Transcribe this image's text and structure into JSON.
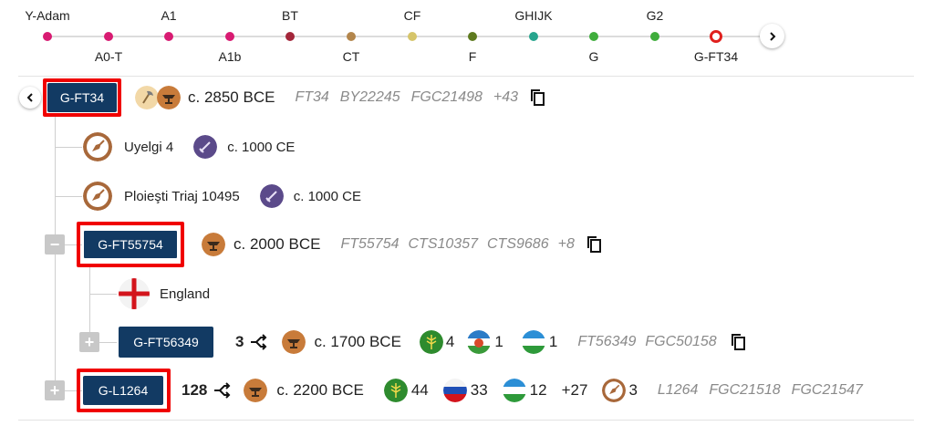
{
  "rail": {
    "nodes": [
      {
        "label": "Y-Adam",
        "pos": "top",
        "color": "#d81b72"
      },
      {
        "label": "A0-T",
        "pos": "bottom",
        "color": "#d81b72"
      },
      {
        "label": "A1",
        "pos": "top",
        "color": "#d81b72"
      },
      {
        "label": "A1b",
        "pos": "bottom",
        "color": "#d81b72"
      },
      {
        "label": "BT",
        "pos": "top",
        "color": "#a3263a"
      },
      {
        "label": "CT",
        "pos": "bottom",
        "color": "#b3864c"
      },
      {
        "label": "CF",
        "pos": "top",
        "color": "#d6c56a"
      },
      {
        "label": "F",
        "pos": "bottom",
        "color": "#5e7a1e"
      },
      {
        "label": "GHIJK",
        "pos": "top",
        "color": "#27a58e"
      },
      {
        "label": "G",
        "pos": "bottom",
        "color": "#3fad3c"
      },
      {
        "label": "G2",
        "pos": "top",
        "color": "#3fad3c"
      },
      {
        "label": "G-FT34",
        "pos": "bottom",
        "color": "#e0201e",
        "current": true
      }
    ]
  },
  "root": {
    "name": "G-FT34",
    "age": "c. 2850 BCE",
    "snps": [
      "FT34",
      "BY22245",
      "FGC21498",
      "+43"
    ]
  },
  "samples": [
    {
      "name": "Uyelgi 4",
      "age": "c. 1000 CE"
    },
    {
      "name": "Ploieşti Triaj 10495",
      "age": "c. 1000 CE"
    }
  ],
  "child1": {
    "name": "G-FT55754",
    "age": "c. 2000 BCE",
    "snps": [
      "FT55754",
      "CTS10357",
      "CTS9686",
      "+8"
    ],
    "country": "England"
  },
  "child2": {
    "name": "G-FT56349",
    "subclades": "3",
    "age": "c. 1700 BCE",
    "counts": [
      "4",
      "1",
      "1"
    ],
    "snps": [
      "FT56349",
      "FGC50158"
    ]
  },
  "child3": {
    "name": "G-L1264",
    "subclades": "128",
    "age": "c. 2200 BCE",
    "counts": [
      "44",
      "33",
      "12"
    ],
    "more": "+27",
    "ancient": "3",
    "snps": [
      "L1264",
      "FGC21518",
      "FGC21547"
    ]
  },
  "colors": {
    "badge": "#123a63",
    "highlight": "#f00000",
    "ancient_brown": "#a8683a",
    "bronze": "#c87b3a",
    "iron": "#5b4a8a",
    "adygea_green": "#2e8b2e"
  }
}
